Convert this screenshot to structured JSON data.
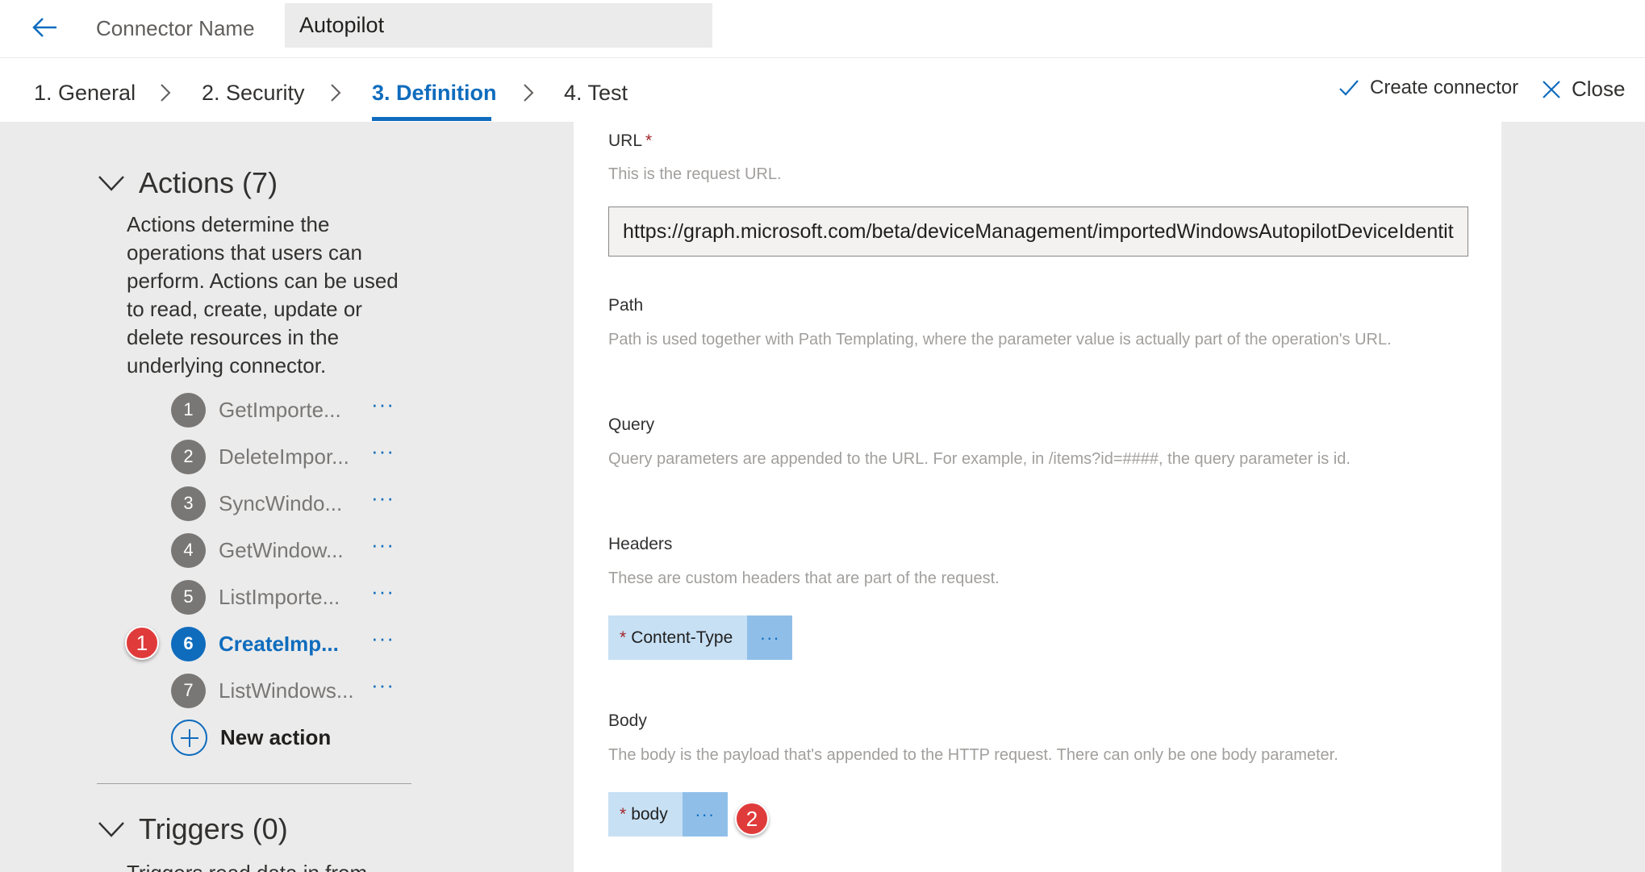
{
  "header": {
    "connector_name_label": "Connector Name",
    "connector_name_value": "Autopilot"
  },
  "wizard": {
    "steps": [
      {
        "label": "1. General"
      },
      {
        "label": "2. Security"
      },
      {
        "label": "3. Definition",
        "active": true
      },
      {
        "label": "4. Test"
      }
    ],
    "create_connector_label": "Create connector",
    "close_label": "Close"
  },
  "actions": {
    "title": "Actions (7)",
    "description": "Actions determine the operations that users can perform. Actions can be used to read, create, update or delete resources in the underlying connector.",
    "items": [
      {
        "num": "1",
        "label": "GetImporte..."
      },
      {
        "num": "2",
        "label": "DeleteImpor..."
      },
      {
        "num": "3",
        "label": "SyncWindo..."
      },
      {
        "num": "4",
        "label": "GetWindow..."
      },
      {
        "num": "5",
        "label": "ListImporte..."
      },
      {
        "num": "6",
        "label": "CreateImp...",
        "active": true
      },
      {
        "num": "7",
        "label": "ListWindows..."
      }
    ],
    "more_glyph": "···",
    "new_action_label": "New action"
  },
  "triggers": {
    "title": "Triggers (0)",
    "description": "Triggers read data in from"
  },
  "callouts": [
    "1",
    "2"
  ],
  "request": {
    "url": {
      "label": "URL",
      "required_mark": "*",
      "description": "This is the request URL.",
      "value": "https://graph.microsoft.com/beta/deviceManagement/importedWindowsAutopilotDeviceIdentities"
    },
    "path": {
      "label": "Path",
      "description": "Path is used together with Path Templating, where the parameter value is actually part of the operation's URL."
    },
    "query": {
      "label": "Query",
      "description": "Query parameters are appended to the URL. For example, in /items?id=####, the query parameter is id."
    },
    "headers": {
      "label": "Headers",
      "description": "These are custom headers that are part of the request.",
      "chip_required_mark": "*",
      "chip_label": "Content-Type"
    },
    "body": {
      "label": "Body",
      "description": "The body is the payload that's appended to the HTTP request. There can only be one body parameter.",
      "chip_required_mark": "*",
      "chip_label": "body"
    }
  },
  "colors": {
    "accent": "#0f6cbd",
    "panel_bg": "#ebebeb",
    "chip_bg": "#c7e0f4",
    "chip_menu_bg": "#8fbfe9",
    "callout": "#e03b3b",
    "required": "#a4262c"
  },
  "icons": {
    "back": "back-arrow-icon",
    "step_separator": "chevron-right-icon",
    "create": "checkmark-icon",
    "close": "close-icon",
    "section_toggle": "chevron-down-icon",
    "add": "add-icon"
  }
}
